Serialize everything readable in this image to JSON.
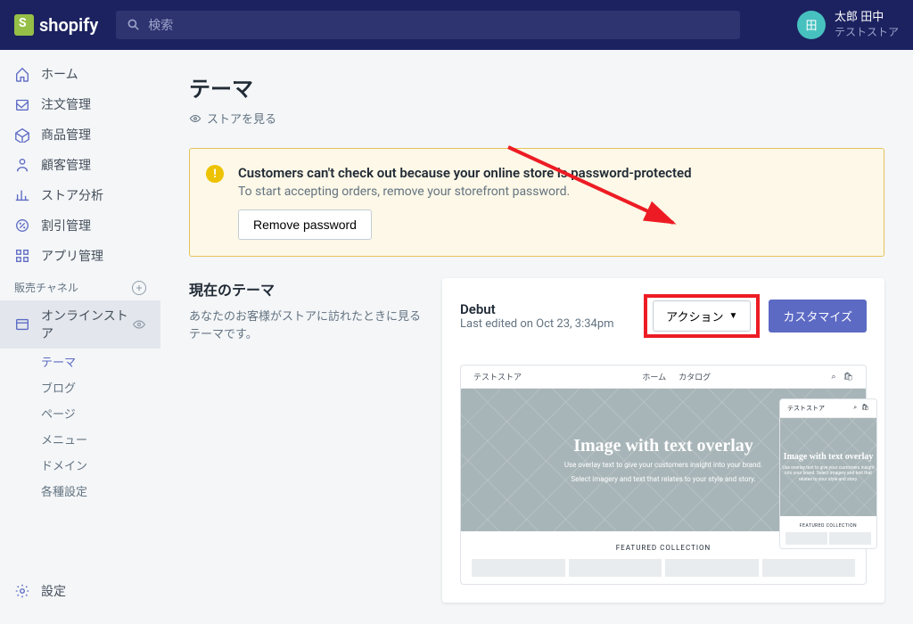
{
  "brand": "shopify",
  "search": {
    "placeholder": "検索"
  },
  "user": {
    "name": "太郎 田中",
    "store": "テストストア",
    "initial": "田"
  },
  "nav": {
    "items": [
      {
        "label": "ホーム"
      },
      {
        "label": "注文管理"
      },
      {
        "label": "商品管理"
      },
      {
        "label": "顧客管理"
      },
      {
        "label": "ストア分析"
      },
      {
        "label": "割引管理"
      },
      {
        "label": "アプリ管理"
      }
    ],
    "section": "販売チャネル",
    "online_store": "オンラインストア",
    "sub": [
      "テーマ",
      "ブログ",
      "ページ",
      "メニュー",
      "ドメイン",
      "各種設定"
    ],
    "settings": "設定"
  },
  "page": {
    "title": "テーマ",
    "view_store": "ストアを見る"
  },
  "alert": {
    "title": "Customers can't check out because your online store is password-protected",
    "text": "To start accepting orders, remove your storefront password.",
    "button": "Remove password"
  },
  "section": {
    "title": "現在のテーマ",
    "desc": "あなたのお客様がストアに訪れたときに見るテーマです。"
  },
  "theme": {
    "name": "Debut",
    "meta": "Last edited on Oct 23, 3:34pm",
    "action": "アクション",
    "customize": "カスタマイズ"
  },
  "preview": {
    "store": "テストストア",
    "nav1": "ホーム",
    "nav2": "カタログ",
    "hero_title": "Image with text overlay",
    "hero_text1": "Use overlay text to give your customers insight into your brand.",
    "hero_text2": "Select imagery and text that relates to your style and story.",
    "collection": "FEATURED COLLECTION",
    "mobile_hero": "Image with text overlay",
    "mobile_text": "Use overlay text to give your customers insight into your brand. Select imagery and text that relates to your style and story."
  }
}
